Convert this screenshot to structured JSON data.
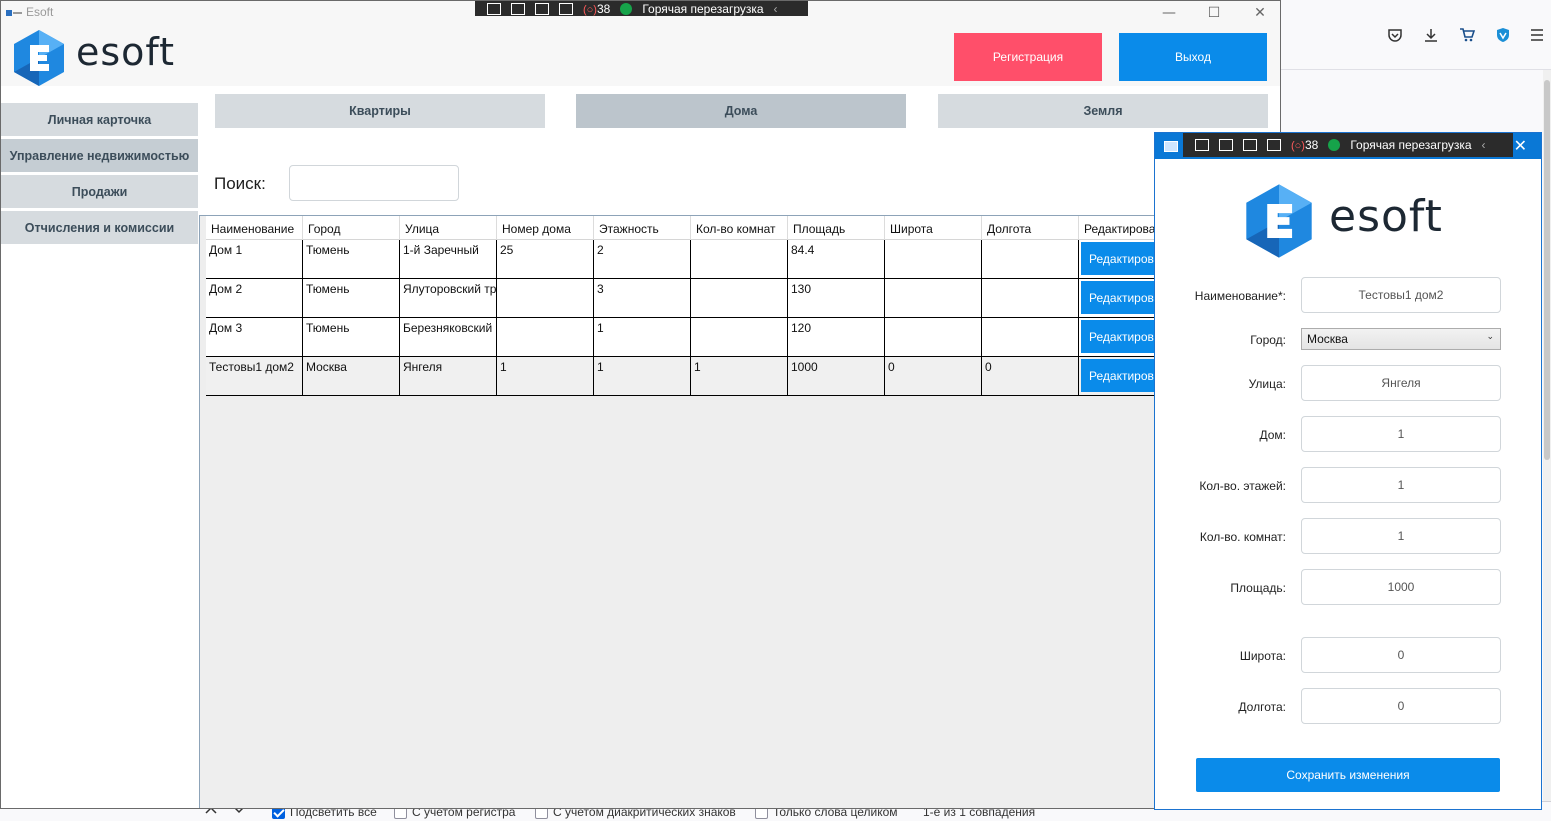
{
  "app": {
    "window_title": "Esoft",
    "logo_text": "esoft",
    "register_label": "Регистрация",
    "exit_label": "Выход"
  },
  "devtools": {
    "counter": "38",
    "hot_reload": "Горячая перезагрузка"
  },
  "sidebar": {
    "items": [
      {
        "label": "Личная карточка"
      },
      {
        "label": "Управление недвижимостью"
      },
      {
        "label": "Продажи"
      },
      {
        "label": "Отчисления и комиссии"
      }
    ]
  },
  "tabs": [
    {
      "label": "Квартиры"
    },
    {
      "label": "Дома"
    },
    {
      "label": "Земля"
    }
  ],
  "search": {
    "label": "Поиск:",
    "value": ""
  },
  "table": {
    "columns": [
      "Наименование",
      "Город",
      "Улица",
      "Номер дома",
      "Этажность",
      "Кол-во комнат",
      "Площадь",
      "Широта",
      "Долгота",
      "Редактирова"
    ],
    "edit_label": "Редактиров",
    "rows": [
      [
        "Дом 1",
        "Тюмень",
        "1-й Заречный",
        "25",
        "2",
        "",
        "84.4",
        "",
        ""
      ],
      [
        "Дом 2",
        "Тюмень",
        "Ялуторовский тр",
        "",
        "3",
        "",
        "130",
        "",
        ""
      ],
      [
        "Дом 3",
        "Тюмень",
        "Березняковский",
        "",
        "1",
        "",
        "120",
        "",
        ""
      ],
      [
        "Тестовы1 дом2",
        "Москва",
        "Янгеля",
        "1",
        "1",
        "1",
        "1000",
        "0",
        "0"
      ]
    ]
  },
  "edit_dialog": {
    "logo_text": "esoft",
    "fields": {
      "name": {
        "label": "Наименование*:",
        "value": "Тестовы1 дом2"
      },
      "city": {
        "label": "Город:",
        "value": "Москва"
      },
      "street": {
        "label": "Улица:",
        "value": "Янгеля"
      },
      "house": {
        "label": "Дом:",
        "value": "1"
      },
      "floors": {
        "label": "Кол-во. этажей:",
        "value": "1"
      },
      "rooms": {
        "label": "Кол-во. комнат:",
        "value": "1"
      },
      "area": {
        "label": "Площадь:",
        "value": "1000"
      },
      "latitude": {
        "label": "Широта:",
        "value": "0"
      },
      "longitude": {
        "label": "Долгота:",
        "value": "0"
      }
    },
    "save_label": "Сохранить изменения"
  },
  "findbar": {
    "highlight_all": "Подсветить все",
    "match_case": "С учетом регистра",
    "match_diacritics": "С учетом диакритических знаков",
    "whole_words": "Только слова целиком",
    "result": "1-е из 1 совпадения"
  },
  "colors": {
    "primary": "#0a8bea",
    "danger": "#ff4f6a",
    "nav_bg": "#d6dbdf",
    "nav_text": "#3c4d5a"
  }
}
